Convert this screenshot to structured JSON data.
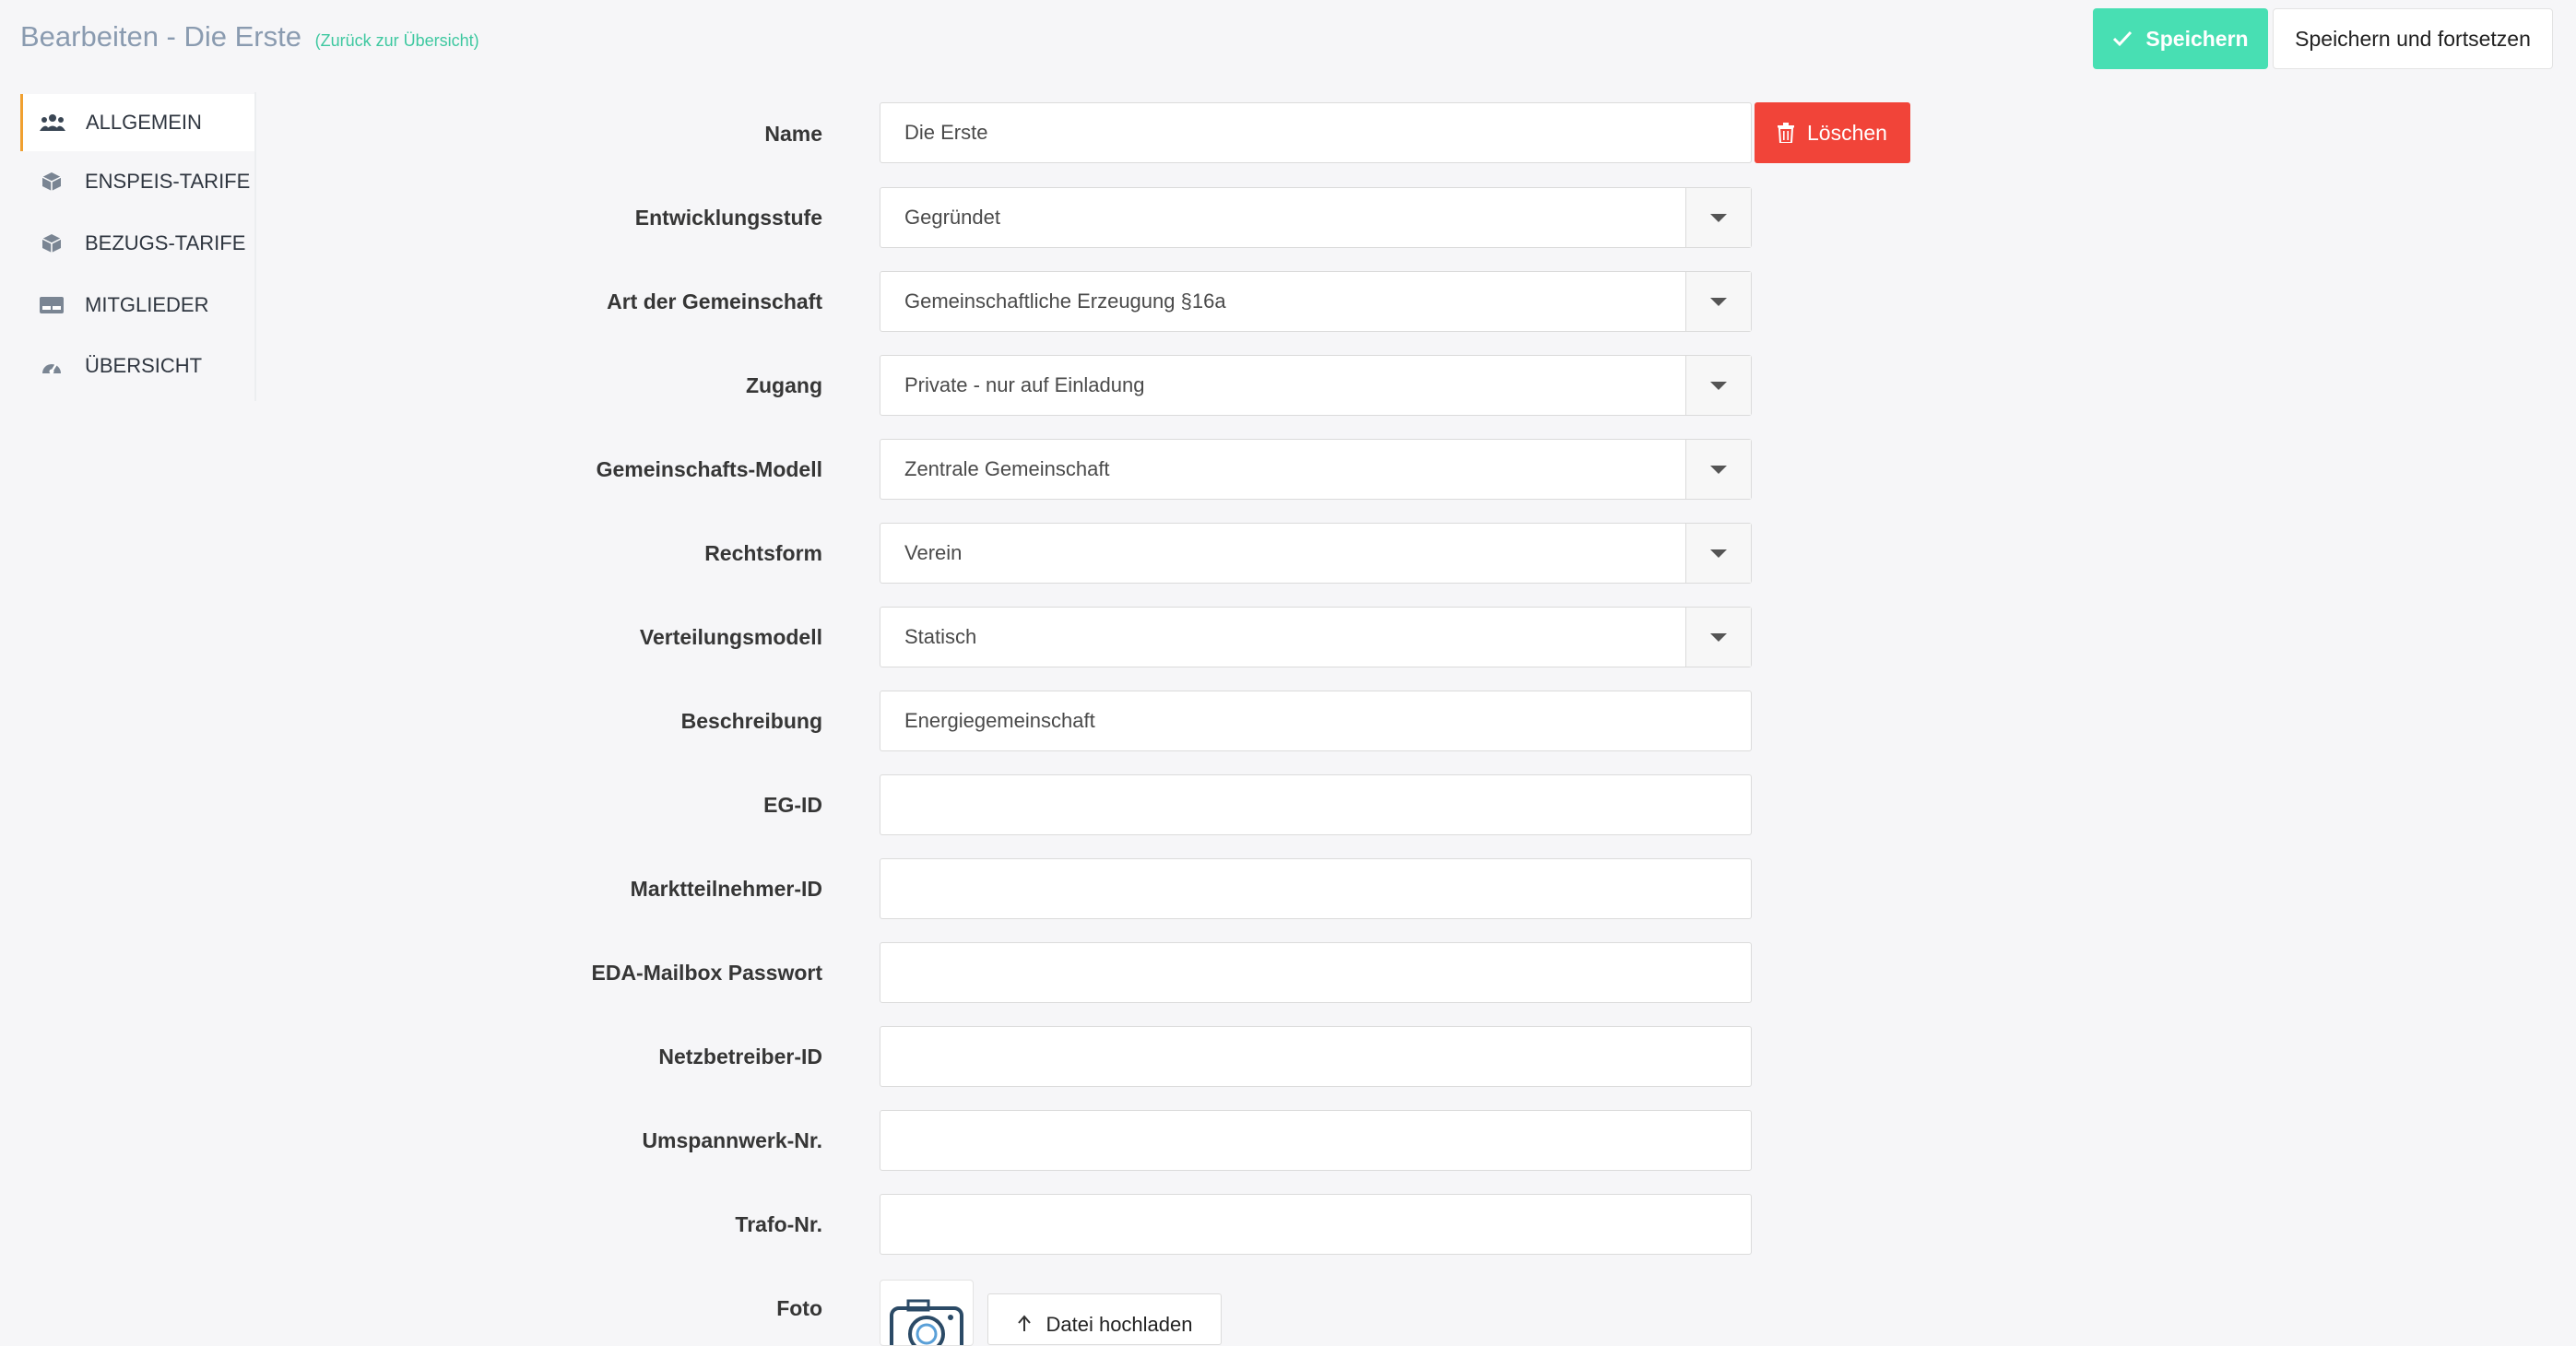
{
  "header": {
    "title": "Bearbeiten - Die Erste",
    "back_link": "(Zurück zur Übersicht)",
    "save_label": "Speichern",
    "save_continue_label": "Speichern und fortsetzen"
  },
  "sidebar": {
    "items": [
      {
        "label": "ALLGEMEIN",
        "icon": "users-icon",
        "active": true
      },
      {
        "label": "ENSPEIS-TARIFE",
        "icon": "cube-icon"
      },
      {
        "label": "BEZUGS-TARIFE",
        "icon": "cube-icon"
      },
      {
        "label": "MITGLIEDER",
        "icon": "id-card-icon"
      },
      {
        "label": "ÜBERSICHT",
        "icon": "dashboard-icon"
      }
    ]
  },
  "form": {
    "name": {
      "label": "Name",
      "value": "Die Erste"
    },
    "delete_label": "Löschen",
    "entwicklungsstufe": {
      "label": "Entwicklungsstufe",
      "value": "Gegründet"
    },
    "art": {
      "label": "Art der Gemeinschaft",
      "value": "Gemeinschaftliche Erzeugung §16a"
    },
    "zugang": {
      "label": "Zugang",
      "value": "Private - nur auf Einladung"
    },
    "modell": {
      "label": "Gemeinschafts-Modell",
      "value": "Zentrale Gemeinschaft"
    },
    "rechtsform": {
      "label": "Rechtsform",
      "value": "Verein"
    },
    "verteilung": {
      "label": "Verteilungsmodell",
      "value": "Statisch"
    },
    "beschreibung": {
      "label": "Beschreibung",
      "value": "Energiegemeinschaft"
    },
    "eg_id": {
      "label": "EG-ID",
      "value": ""
    },
    "marktteilnehmer": {
      "label": "Marktteilnehmer-ID",
      "value": ""
    },
    "eda": {
      "label": "EDA-Mailbox Passwort",
      "value": ""
    },
    "netzbetreiber": {
      "label": "Netzbetreiber-ID",
      "value": ""
    },
    "umspannwerk": {
      "label": "Umspannwerk-Nr.",
      "value": ""
    },
    "trafo": {
      "label": "Trafo-Nr.",
      "value": ""
    },
    "foto": {
      "label": "Foto",
      "upload_label": "Datei hochladen"
    }
  },
  "colors": {
    "accent": "#48dfb3",
    "danger": "#f14439",
    "sidebar_active": "#f0a030"
  }
}
